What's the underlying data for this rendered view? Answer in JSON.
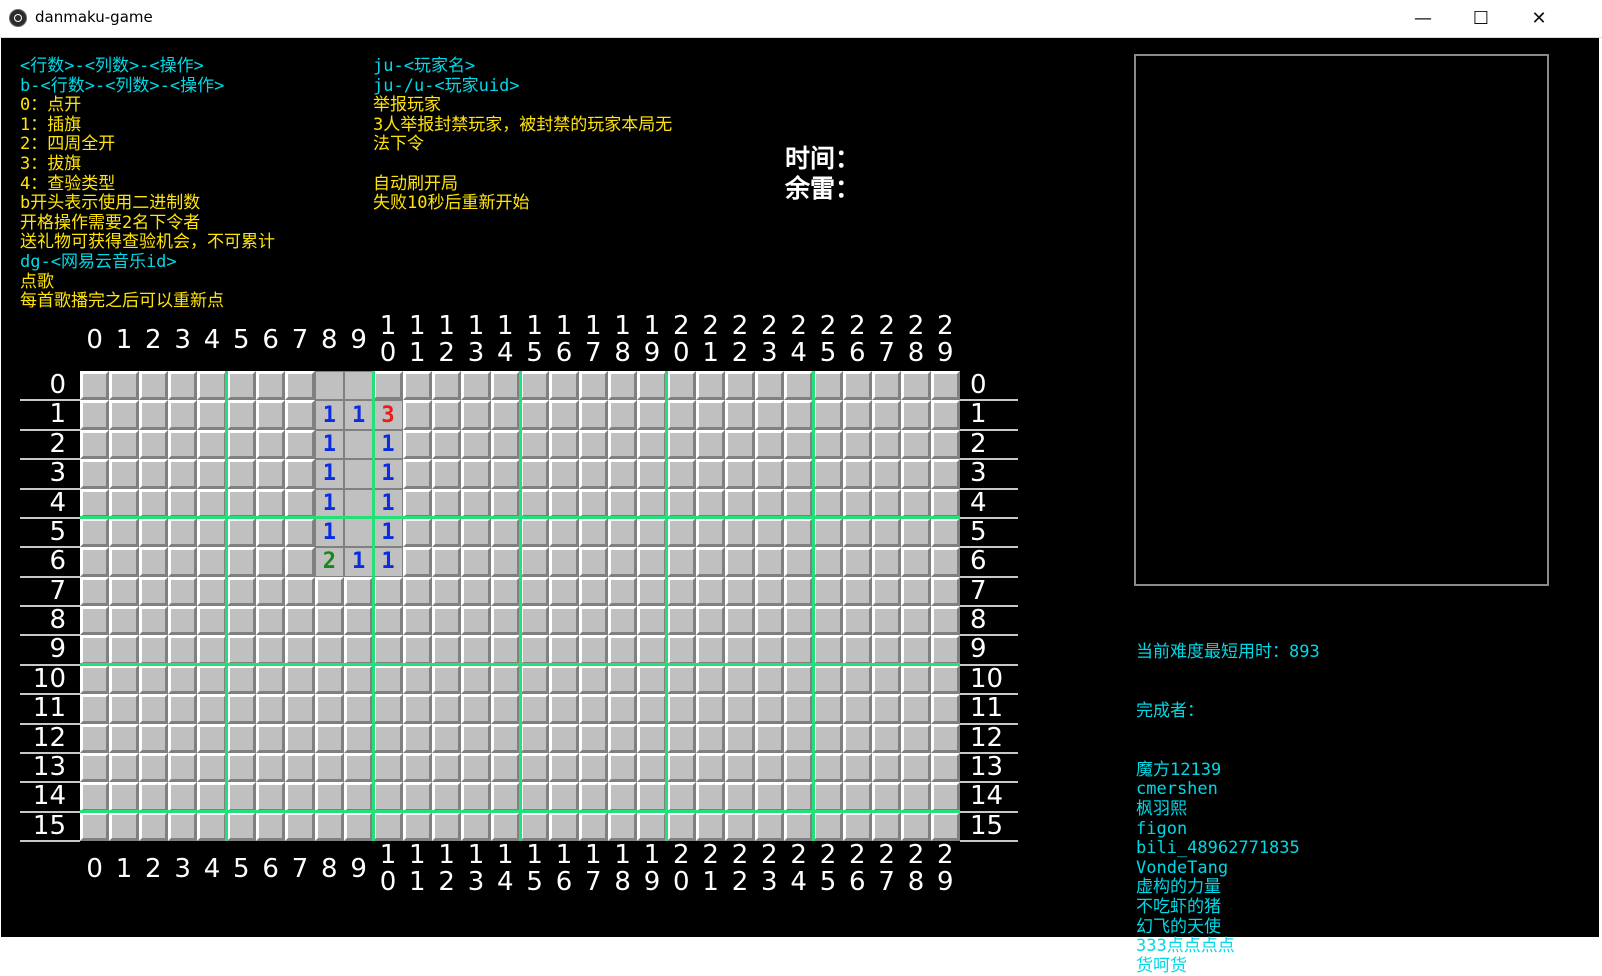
{
  "window": {
    "title": "danmaku-game",
    "minimize": "—",
    "maximize": "☐",
    "close": "✕"
  },
  "help_left": [
    {
      "text": "<行数>-<列数>-<操作>",
      "color": "cyan"
    },
    {
      "text": "b-<行数>-<列数>-<操作>",
      "color": "cyan"
    },
    {
      "text": "0：点开",
      "color": "yellow"
    },
    {
      "text": "1：插旗",
      "color": "yellow"
    },
    {
      "text": "2：四周全开",
      "color": "yellow"
    },
    {
      "text": "3：拔旗",
      "color": "yellow"
    },
    {
      "text": "4：查验类型",
      "color": "yellow"
    },
    {
      "text": "b开头表示使用二进制数",
      "color": "yellow"
    },
    {
      "text": "开格操作需要2名下令者",
      "color": "yellow"
    },
    {
      "text": "送礼物可获得查验机会，不可累计",
      "color": "yellow"
    },
    {
      "text": "dg-<网易云音乐id>",
      "color": "cyan"
    },
    {
      "text": "点歌",
      "color": "yellow"
    },
    {
      "text": "每首歌播完之后可以重新点",
      "color": "yellow"
    }
  ],
  "help_right": [
    {
      "text": "ju-<玩家名>",
      "color": "cyan"
    },
    {
      "text": "ju-/u-<玩家uid>",
      "color": "cyan"
    },
    {
      "text": "举报玩家",
      "color": "yellow"
    },
    {
      "text": "3人举报封禁玩家，被封禁的玩家本局无",
      "color": "yellow"
    },
    {
      "text": "法下令",
      "color": "yellow"
    },
    {
      "text": "",
      "color": "yellow"
    },
    {
      "text": "自动刷开局",
      "color": "yellow"
    },
    {
      "text": "失败10秒后重新开始",
      "color": "yellow"
    }
  ],
  "status": {
    "time_label": "时间：",
    "mines_label": "余雷："
  },
  "records": {
    "best_time": "当前难度最短用时：893",
    "finishers_label": "完成者：",
    "finishers": [
      "魔方12139",
      "cmershen",
      "枫羽熙",
      "figon",
      "bili_48962771835",
      "VondeTang",
      "虚构的力量",
      "不吃虾的猪",
      "幻飞的天使",
      "333点点点点",
      "货呵货"
    ]
  },
  "board": {
    "rows": 16,
    "cols": 30,
    "number_colors": {
      "1": "#0a2de0",
      "2": "#168a16",
      "3": "#f01818"
    },
    "grid_line_color": "#22e07a",
    "opened": [
      {
        "r": 0,
        "c": 8,
        "v": ""
      },
      {
        "r": 0,
        "c": 9,
        "v": ""
      },
      {
        "r": 1,
        "c": 8,
        "v": "1"
      },
      {
        "r": 1,
        "c": 9,
        "v": "1"
      },
      {
        "r": 1,
        "c": 10,
        "v": "3"
      },
      {
        "r": 2,
        "c": 8,
        "v": "1"
      },
      {
        "r": 2,
        "c": 9,
        "v": ""
      },
      {
        "r": 2,
        "c": 10,
        "v": "1"
      },
      {
        "r": 3,
        "c": 8,
        "v": "1"
      },
      {
        "r": 3,
        "c": 9,
        "v": ""
      },
      {
        "r": 3,
        "c": 10,
        "v": "1"
      },
      {
        "r": 4,
        "c": 8,
        "v": "1"
      },
      {
        "r": 4,
        "c": 9,
        "v": ""
      },
      {
        "r": 4,
        "c": 10,
        "v": "1"
      },
      {
        "r": 5,
        "c": 8,
        "v": "1"
      },
      {
        "r": 5,
        "c": 9,
        "v": ""
      },
      {
        "r": 5,
        "c": 10,
        "v": "1"
      },
      {
        "r": 6,
        "c": 8,
        "v": "2"
      },
      {
        "r": 6,
        "c": 9,
        "v": "1"
      },
      {
        "r": 6,
        "c": 10,
        "v": "1"
      }
    ]
  },
  "col_labels": [
    "0",
    "1",
    "2",
    "3",
    "4",
    "5",
    "6",
    "7",
    "8",
    "9",
    "1\n0",
    "1\n1",
    "1\n2",
    "1\n3",
    "1\n4",
    "1\n5",
    "1\n6",
    "1\n7",
    "1\n8",
    "1\n9",
    "2\n0",
    "2\n1",
    "2\n2",
    "2\n3",
    "2\n4",
    "2\n5",
    "2\n6",
    "2\n7",
    "2\n8",
    "2\n9"
  ],
  "row_labels": [
    "0",
    "1",
    "2",
    "3",
    "4",
    "5",
    "6",
    "7",
    "8",
    "9",
    "10",
    "11",
    "12",
    "13",
    "14",
    "15"
  ],
  "colors": {
    "cyan": "#00d8e6",
    "yellow": "#ffe40a",
    "background": "#000000",
    "cell": "#c0c0c0"
  }
}
